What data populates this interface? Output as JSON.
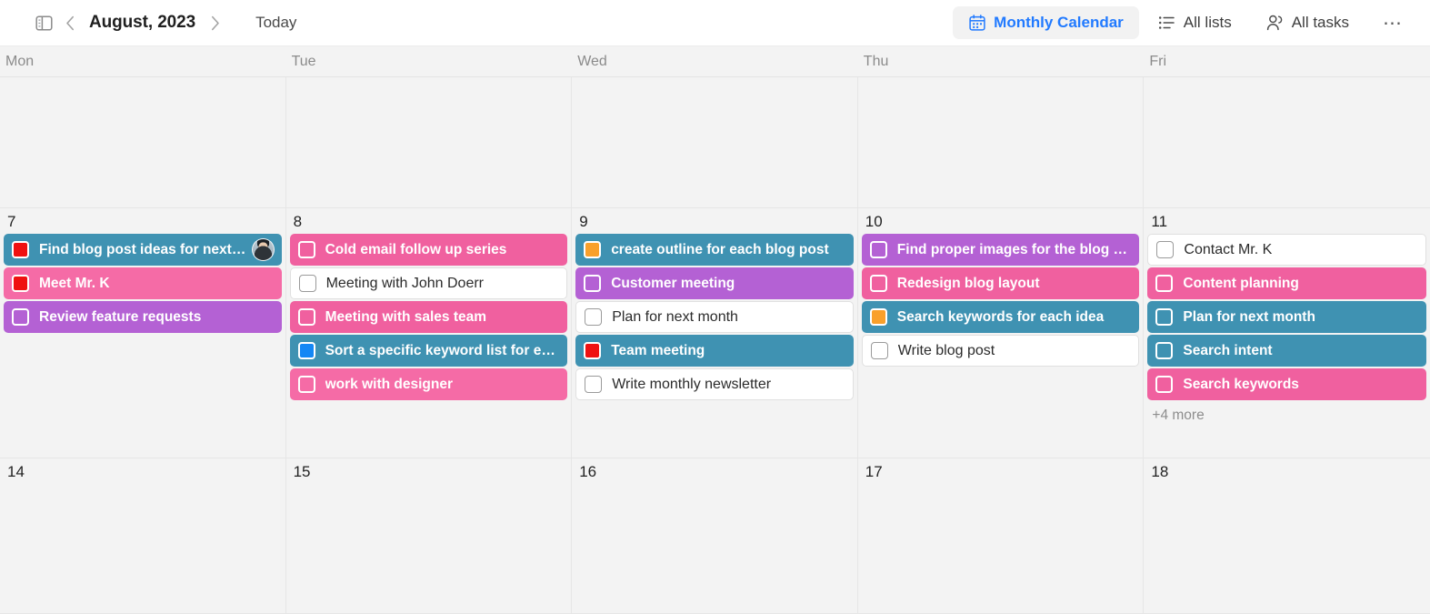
{
  "toolbar": {
    "sidebar_toggle_icon": "sidebar-panel-icon",
    "prev_icon": "chevron-left-icon",
    "next_icon": "chevron-right-icon",
    "month_title": "August, 2023",
    "today_label": "Today",
    "views": [
      {
        "label": "Monthly Calendar",
        "icon": "calendar-icon",
        "active": true
      },
      {
        "label": "All lists",
        "icon": "list-icon",
        "active": false
      },
      {
        "label": "All tasks",
        "icon": "people-icon",
        "active": false
      }
    ],
    "more_label": "⋯",
    "accent_color": "#217aff"
  },
  "weekdays": [
    "Mon",
    "Tue",
    "Wed",
    "Thu",
    "Fri"
  ],
  "colors": {
    "teal": "#3f92b2",
    "pink": "#f0609f",
    "pink_light": "#f56ba6",
    "purple": "#b461d4",
    "white": "#ffffff",
    "checkbox_red": "#ef1111",
    "checkbox_orange": "#f9a02b",
    "checkbox_blue": "#1487f5",
    "grid_bg": "#f3f3f3"
  },
  "weeks": [
    {
      "days": [
        {
          "daynum": "",
          "tasks": []
        },
        {
          "daynum": "",
          "tasks": []
        },
        {
          "daynum": "",
          "tasks": []
        },
        {
          "daynum": "",
          "tasks": []
        },
        {
          "daynum": "",
          "tasks": []
        }
      ]
    },
    {
      "days": [
        {
          "daynum": "7",
          "tasks": [
            {
              "label": "Find blog post ideas for next ...",
              "color": "teal",
              "check": "red",
              "avatar": true
            },
            {
              "label": "Meet Mr. K",
              "color": "pink_light",
              "check": "red"
            },
            {
              "label": "Review feature requests",
              "color": "purple",
              "check": "none"
            }
          ]
        },
        {
          "daynum": "8",
          "tasks": [
            {
              "label": "Cold email follow up series",
              "color": "pink",
              "check": "none"
            },
            {
              "label": "Meeting with John Doerr",
              "color": "white",
              "check": "none"
            },
            {
              "label": "Meeting with sales team",
              "color": "pink",
              "check": "none"
            },
            {
              "label": "Sort a specific keyword list for eac...",
              "color": "teal",
              "check": "blue"
            },
            {
              "label": "work with designer",
              "color": "pink_light",
              "check": "none"
            }
          ]
        },
        {
          "daynum": "9",
          "tasks": [
            {
              "label": "create outline for each blog post",
              "color": "teal",
              "check": "orange"
            },
            {
              "label": "Customer meeting",
              "color": "purple",
              "check": "none"
            },
            {
              "label": "Plan for next month",
              "color": "white",
              "check": "none"
            },
            {
              "label": "Team meeting",
              "color": "teal",
              "check": "red"
            },
            {
              "label": "Write monthly newsletter",
              "color": "white",
              "check": "none"
            }
          ]
        },
        {
          "daynum": "10",
          "tasks": [
            {
              "label": "Find proper images for the blog p...",
              "color": "purple",
              "check": "none"
            },
            {
              "label": "Redesign blog layout",
              "color": "pink",
              "check": "none"
            },
            {
              "label": "Search keywords for each idea",
              "color": "teal",
              "check": "orange"
            },
            {
              "label": "Write blog post",
              "color": "white",
              "check": "none"
            }
          ]
        },
        {
          "daynum": "11",
          "tasks": [
            {
              "label": "Contact Mr. K",
              "color": "white",
              "check": "none"
            },
            {
              "label": "Content planning",
              "color": "pink",
              "check": "none"
            },
            {
              "label": "Plan for next month",
              "color": "teal",
              "check": "none"
            },
            {
              "label": "Search intent",
              "color": "teal",
              "check": "none"
            },
            {
              "label": "Search keywords",
              "color": "pink",
              "check": "none"
            }
          ],
          "more": "+4 more"
        }
      ]
    },
    {
      "days": [
        {
          "daynum": "14",
          "tasks": []
        },
        {
          "daynum": "15",
          "tasks": []
        },
        {
          "daynum": "16",
          "tasks": []
        },
        {
          "daynum": "17",
          "tasks": []
        },
        {
          "daynum": "18",
          "tasks": []
        }
      ]
    }
  ]
}
